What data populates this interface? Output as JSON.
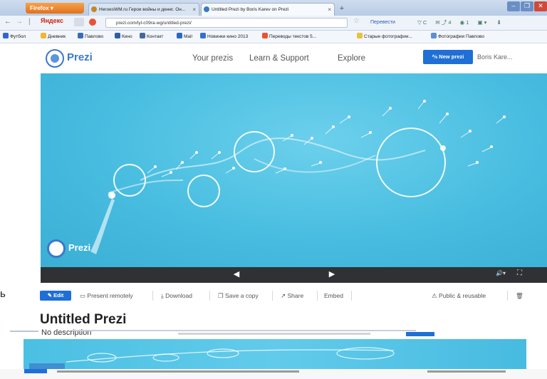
{
  "browser": {
    "app_button": "Firefox",
    "tabs": [
      {
        "title": "HeroesWM.ru Герои войны и денег. Он..."
      },
      {
        "title": "Untitled Prezi by Boris Karev on Prezi"
      }
    ],
    "new_tab": "+",
    "url": "prezi.com/lyl-c09ra-wg/untitled-prezi/",
    "search_engine": "Яндекс",
    "translate_label": "Перевести",
    "bookmarks": [
      "Футбол",
      "Дневник",
      "Павлово",
      "Кино",
      "Контакт",
      "Mail",
      "Новинки кино 2013",
      "Переводы текстов 5...",
      "Старые фотографии...",
      "Фотографии Павлово"
    ]
  },
  "header": {
    "logo_text": "Prezi",
    "nav": [
      "Your prezis",
      "Learn & Support",
      "Explore"
    ],
    "new_prezi": "New prezi",
    "user": "Boris Kare..."
  },
  "canvas": {
    "logo_text": "Prezi"
  },
  "toolbar": {
    "edit": "Edit",
    "present_remotely": "Present remotely",
    "download": "Download",
    "save_copy": "Save a copy",
    "share": "Share",
    "embed": "Embed",
    "visibility": "Public & reusable"
  },
  "stray_glyph": "ь",
  "prezi": {
    "title": "Untitled Prezi",
    "description": "No description"
  },
  "colors": {
    "accent": "#1f6fd6",
    "canvas": "#48bde0",
    "control_bar": "#2f3134"
  }
}
